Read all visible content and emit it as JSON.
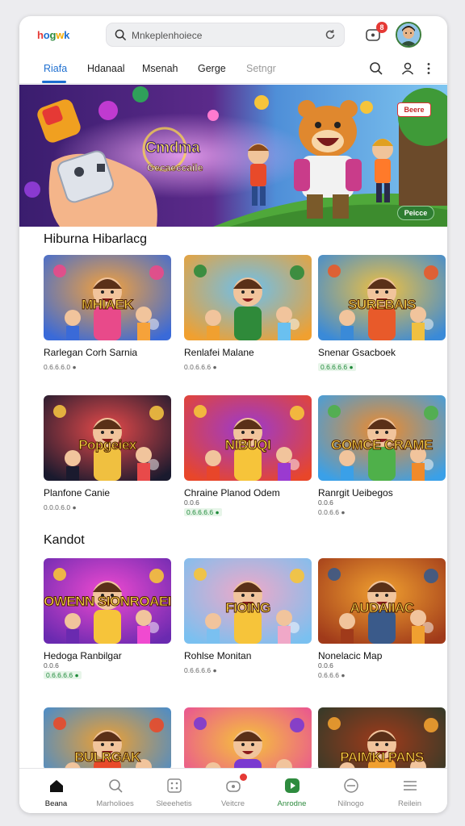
{
  "app": {
    "logo_text": "hogwk",
    "logo_colors": [
      "#e53935",
      "#1e6fd0",
      "#2e8b3e",
      "#f2a900",
      "#1e6fd0",
      "#2e8b3e"
    ]
  },
  "search": {
    "value": "Mnkeplenhoiece"
  },
  "header": {
    "notification_count": "8"
  },
  "tabs": [
    {
      "label": "Riafa",
      "active": true
    },
    {
      "label": "Hdanaal",
      "active": false
    },
    {
      "label": "Msenah",
      "active": false
    },
    {
      "label": "Gerge",
      "active": false
    },
    {
      "label": "Setngr",
      "active": false
    }
  ],
  "hero": {
    "title": "Cmdma",
    "subtitle": "Gecaeccaile",
    "top_button": "Beere",
    "bottom_button": "Peicce"
  },
  "sections": [
    {
      "title": "Hiburna Hibarlacg",
      "cards": [
        {
          "thumb_title": "MHIAEK",
          "name": "Rarlegan Corh Sarnia",
          "meta": "0.6.6.6.0 ●",
          "meta_green": false
        },
        {
          "thumb_title": "",
          "name": "Renlafei Malane",
          "meta": "0.0.6.6.6 ●",
          "meta_green": false
        },
        {
          "thumb_title": "SUREBAIS",
          "name": "Snenar Gsacboek",
          "meta": "0.6.6.6.6 ●",
          "meta_green": true
        }
      ]
    },
    {
      "title": "",
      "cards": [
        {
          "thumb_title": "Popgeiex",
          "name": "Planfone Canie",
          "meta": "0.0.0.6.0 ●",
          "meta_green": false,
          "sub": ""
        },
        {
          "thumb_title": "NIBUQI",
          "name": "Chraine Planod Odem",
          "meta": "0.6.6.6.6 ●",
          "meta_green": true,
          "sub": "0.0.6"
        },
        {
          "thumb_title": "GOMCE CRAME",
          "name": "Ranrgit Ueibegos",
          "meta": "0.0.6.6 ●",
          "meta_green": false,
          "sub": "0.0.6"
        }
      ]
    },
    {
      "title": "Kandot",
      "cards": [
        {
          "thumb_title": "OWENN SIONROAEI",
          "name": "Hedoga Ranbilgar",
          "meta": "0.6.6.6.6 ●",
          "meta_green": true,
          "sub": "0.0.6"
        },
        {
          "thumb_title": "FIOING",
          "name": "Rohlse Monitan",
          "meta": "0.6.6.6.6 ●",
          "meta_green": false,
          "sub": ""
        },
        {
          "thumb_title": "AUDAIIAC",
          "name": "Nonelacic Map",
          "meta": "0.6.6.6 ●",
          "meta_green": false,
          "sub": "0.0.6"
        }
      ]
    },
    {
      "title": "",
      "cards": [
        {
          "thumb_title": "BULRGAK",
          "name": "",
          "meta": "",
          "meta_green": false
        },
        {
          "thumb_title": "",
          "name": "",
          "meta": "",
          "meta_green": false
        },
        {
          "thumb_title": "PAIMKI PANS",
          "name": "",
          "meta": "",
          "meta_green": false
        }
      ]
    }
  ],
  "bottom_nav": [
    {
      "label": "Beana",
      "icon": "home-icon",
      "active": true
    },
    {
      "label": "Marholioes",
      "icon": "search-icon",
      "active": false
    },
    {
      "label": "Sleeehetis",
      "icon": "grid-icon",
      "active": false
    },
    {
      "label": "Veitcre",
      "icon": "gamepad-icon",
      "active": false,
      "badge": true
    },
    {
      "label": "Anrodne",
      "icon": "play-icon",
      "active": false,
      "green": true
    },
    {
      "label": "Nilnogo",
      "icon": "minus-circle-icon",
      "active": false
    },
    {
      "label": "Reilein",
      "icon": "menu-icon",
      "active": false
    }
  ]
}
